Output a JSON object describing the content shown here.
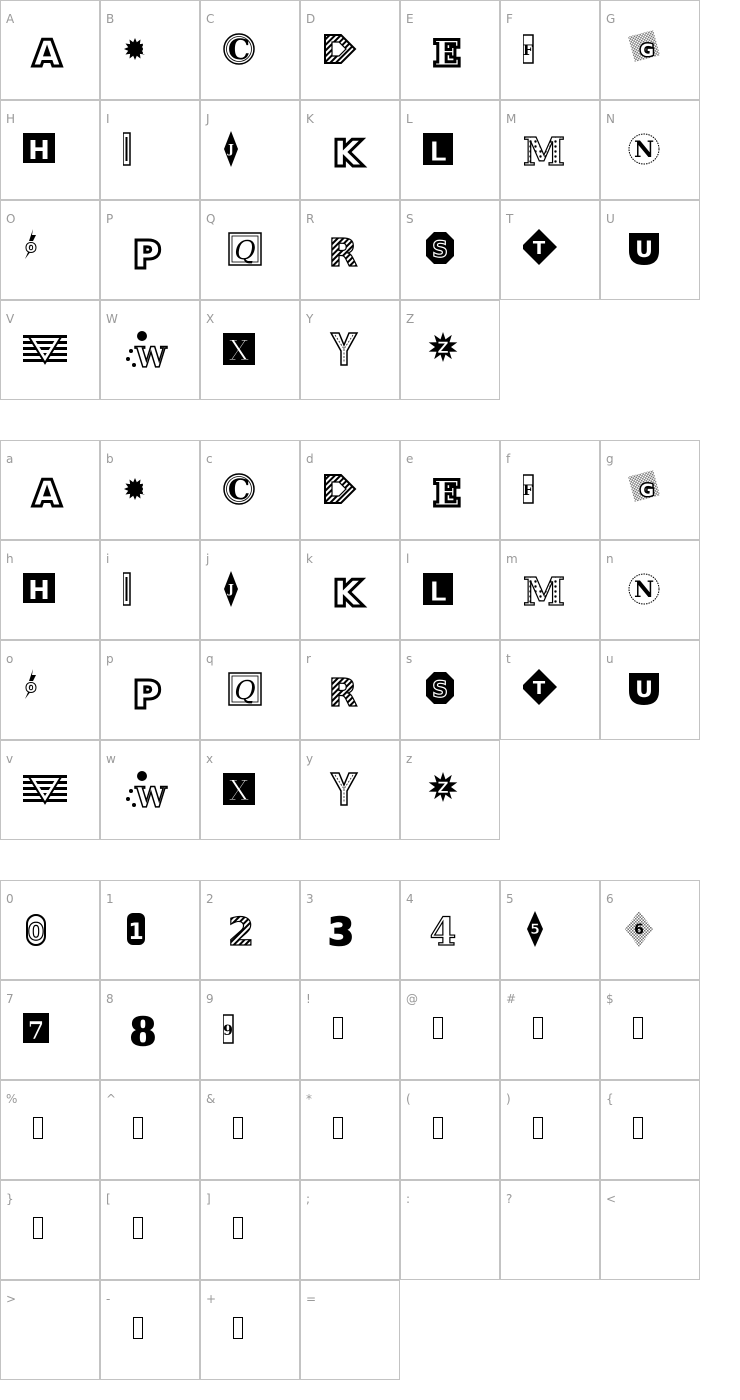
{
  "sections": [
    {
      "name": "uppercase",
      "cells": [
        {
          "label": "A",
          "glyph": "A"
        },
        {
          "label": "B",
          "glyph": "B"
        },
        {
          "label": "C",
          "glyph": "C"
        },
        {
          "label": "D",
          "glyph": "D"
        },
        {
          "label": "E",
          "glyph": "E"
        },
        {
          "label": "F",
          "glyph": "F"
        },
        {
          "label": "G",
          "glyph": "G"
        },
        {
          "label": "H",
          "glyph": "H"
        },
        {
          "label": "I",
          "glyph": "I"
        },
        {
          "label": "J",
          "glyph": "J"
        },
        {
          "label": "K",
          "glyph": "K"
        },
        {
          "label": "L",
          "glyph": "L"
        },
        {
          "label": "M",
          "glyph": "M"
        },
        {
          "label": "N",
          "glyph": "N"
        },
        {
          "label": "O",
          "glyph": "O"
        },
        {
          "label": "P",
          "glyph": "P"
        },
        {
          "label": "Q",
          "glyph": "Q"
        },
        {
          "label": "R",
          "glyph": "R"
        },
        {
          "label": "S",
          "glyph": "S"
        },
        {
          "label": "T",
          "glyph": "T"
        },
        {
          "label": "U",
          "glyph": "U"
        },
        {
          "label": "V",
          "glyph": "V"
        },
        {
          "label": "W",
          "glyph": "W"
        },
        {
          "label": "X",
          "glyph": "X"
        },
        {
          "label": "Y",
          "glyph": "Y"
        },
        {
          "label": "Z",
          "glyph": "Z"
        }
      ]
    },
    {
      "name": "lowercase",
      "cells": [
        {
          "label": "a",
          "glyph": "A"
        },
        {
          "label": "b",
          "glyph": "B"
        },
        {
          "label": "c",
          "glyph": "C"
        },
        {
          "label": "d",
          "glyph": "D"
        },
        {
          "label": "e",
          "glyph": "E"
        },
        {
          "label": "f",
          "glyph": "F"
        },
        {
          "label": "g",
          "glyph": "G"
        },
        {
          "label": "h",
          "glyph": "H"
        },
        {
          "label": "i",
          "glyph": "I"
        },
        {
          "label": "j",
          "glyph": "J"
        },
        {
          "label": "k",
          "glyph": "K"
        },
        {
          "label": "l",
          "glyph": "L"
        },
        {
          "label": "m",
          "glyph": "M"
        },
        {
          "label": "n",
          "glyph": "N"
        },
        {
          "label": "o",
          "glyph": "O"
        },
        {
          "label": "p",
          "glyph": "P"
        },
        {
          "label": "q",
          "glyph": "Q"
        },
        {
          "label": "r",
          "glyph": "R"
        },
        {
          "label": "s",
          "glyph": "S"
        },
        {
          "label": "t",
          "glyph": "T"
        },
        {
          "label": "u",
          "glyph": "U"
        },
        {
          "label": "v",
          "glyph": "V"
        },
        {
          "label": "w",
          "glyph": "W"
        },
        {
          "label": "x",
          "glyph": "X"
        },
        {
          "label": "y",
          "glyph": "Y"
        },
        {
          "label": "z",
          "glyph": "Z"
        }
      ]
    },
    {
      "name": "numbers-symbols",
      "cells": [
        {
          "label": "0",
          "glyph": "0"
        },
        {
          "label": "1",
          "glyph": "1"
        },
        {
          "label": "2",
          "glyph": "2"
        },
        {
          "label": "3",
          "glyph": "3"
        },
        {
          "label": "4",
          "glyph": "4"
        },
        {
          "label": "5",
          "glyph": "5"
        },
        {
          "label": "6",
          "glyph": "6"
        },
        {
          "label": "7",
          "glyph": "7"
        },
        {
          "label": "8",
          "glyph": "8"
        },
        {
          "label": "9",
          "glyph": "9"
        },
        {
          "label": "!",
          "glyph": "missing"
        },
        {
          "label": "@",
          "glyph": "missing"
        },
        {
          "label": "#",
          "glyph": "missing"
        },
        {
          "label": "$",
          "glyph": "missing"
        },
        {
          "label": "%",
          "glyph": "missing"
        },
        {
          "label": "^",
          "glyph": "missing"
        },
        {
          "label": "&",
          "glyph": "missing"
        },
        {
          "label": "*",
          "glyph": "missing"
        },
        {
          "label": "(",
          "glyph": "missing"
        },
        {
          "label": ")",
          "glyph": "missing"
        },
        {
          "label": "{",
          "glyph": "missing"
        },
        {
          "label": "}",
          "glyph": "missing"
        },
        {
          "label": "[",
          "glyph": "missing"
        },
        {
          "label": "]",
          "glyph": "missing"
        },
        {
          "label": ";",
          "glyph": "blank"
        },
        {
          "label": ":",
          "glyph": "blank"
        },
        {
          "label": "?",
          "glyph": "blank"
        },
        {
          "label": "<",
          "glyph": "blank"
        },
        {
          "label": ">",
          "glyph": "blank"
        },
        {
          "label": "-",
          "glyph": "missing"
        },
        {
          "label": "+",
          "glyph": "missing"
        },
        {
          "label": "=",
          "glyph": "blank"
        }
      ]
    }
  ]
}
